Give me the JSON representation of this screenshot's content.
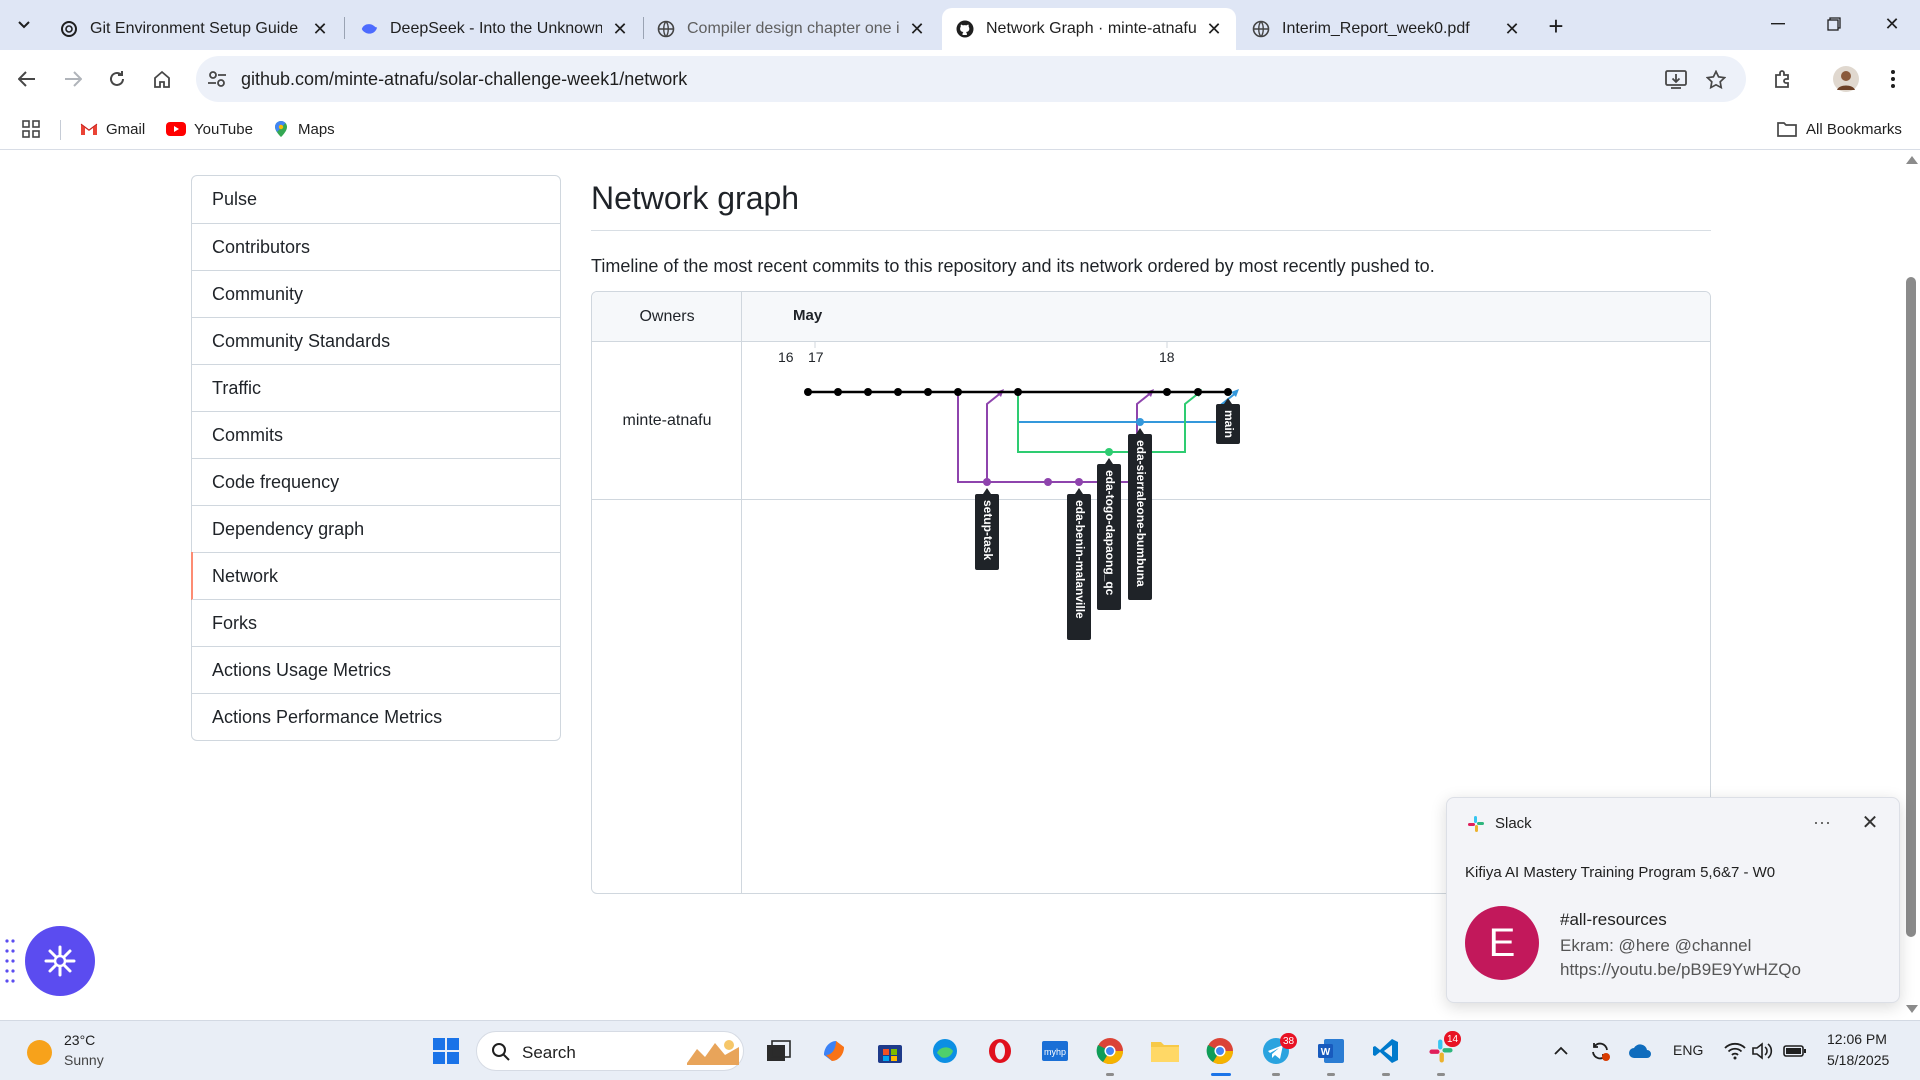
{
  "browser": {
    "tabs": [
      {
        "title": "Git Environment Setup Guide",
        "icon": "openai-icon",
        "active": false
      },
      {
        "title": "DeepSeek - Into the Unknown",
        "icon": "deepseek-icon",
        "active": false
      },
      {
        "title": "Compiler design chapter one in",
        "icon": "globe-icon",
        "active": false
      },
      {
        "title": "Network Graph · minte-atnafu/s",
        "icon": "github-icon",
        "active": true
      },
      {
        "title": "Interim_Report_week0.pdf",
        "icon": "globe-icon",
        "active": false
      }
    ],
    "url": "github.com/minte-atnafu/solar-challenge-week1/network",
    "bookmarks": [
      {
        "label": "Gmail",
        "icon": "gmail-icon"
      },
      {
        "label": "YouTube",
        "icon": "youtube-icon"
      },
      {
        "label": "Maps",
        "icon": "maps-icon"
      }
    ],
    "all_bookmarks": "All Bookmarks"
  },
  "sidebar": {
    "items": [
      {
        "label": "Pulse"
      },
      {
        "label": "Contributors"
      },
      {
        "label": "Community"
      },
      {
        "label": "Community Standards"
      },
      {
        "label": "Traffic"
      },
      {
        "label": "Commits"
      },
      {
        "label": "Code frequency"
      },
      {
        "label": "Dependency graph"
      },
      {
        "label": "Network",
        "selected": true
      },
      {
        "label": "Forks"
      },
      {
        "label": "Actions Usage Metrics"
      },
      {
        "label": "Actions Performance Metrics"
      }
    ]
  },
  "main": {
    "title": "Network graph",
    "description": "Timeline of the most recent commits to this repository and its network ordered by most recently pushed to.",
    "graph": {
      "owners_header": "Owners",
      "month": "May",
      "owner": "minte-atnafu",
      "day_labels": [
        "16",
        "17",
        "18"
      ],
      "branches": [
        {
          "name": "main",
          "color": "#000000"
        },
        {
          "name": "setup-task",
          "color": "#8e44ad"
        },
        {
          "name": "eda-benin-malanville",
          "color": "#8e44ad"
        },
        {
          "name": "eda-togo-dapaong_qc",
          "color": "#2ecc71"
        },
        {
          "name": "eda-sierraleone-bumbuna",
          "color": "#3498db"
        }
      ]
    }
  },
  "slack_toast": {
    "app": "Slack",
    "more": "···",
    "workspace": "Kifiya AI Mastery Training Program 5,6&7 - W0",
    "avatar_letter": "E",
    "channel": "#all-resources",
    "message": "Ekram: @here @channel https://youtu.be/pB9E9YwHZQo"
  },
  "taskbar": {
    "temperature": "23°C",
    "condition": "Sunny",
    "search_label": "Search",
    "telegram_badge": "38",
    "slack_badge": "14",
    "language": "ENG",
    "time": "12:06 PM",
    "date": "5/18/2025"
  }
}
